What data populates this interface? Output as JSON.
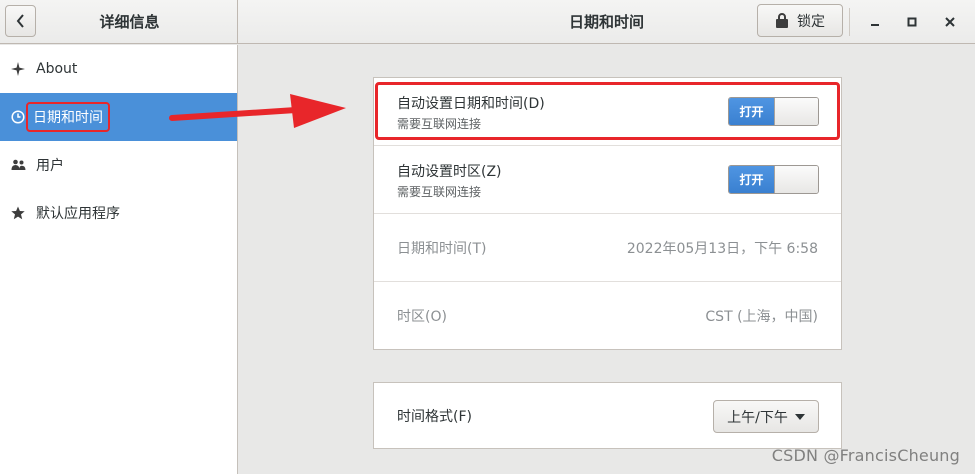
{
  "header": {
    "back_icon": "chevron-left-icon",
    "panel_title": "详细信息",
    "title": "日期和时间",
    "lock_label": "锁定",
    "lock_icon": "lock-icon"
  },
  "window_controls": {
    "minimize_icon": "minimize-icon",
    "maximize_icon": "maximize-icon",
    "close_icon": "close-icon"
  },
  "sidebar": {
    "items": [
      {
        "label": "About",
        "icon": "star-sparkle-icon"
      },
      {
        "label": "日期和时间",
        "icon": "clock-icon",
        "selected": true
      },
      {
        "label": "用户",
        "icon": "users-icon"
      },
      {
        "label": "默认应用程序",
        "icon": "star-icon"
      }
    ]
  },
  "settings": {
    "auto_datetime": {
      "title": "自动设置日期和时间(D)",
      "subtitle": "需要互联网连接",
      "switch_label": "打开"
    },
    "auto_timezone": {
      "title": "自动设置时区(Z)",
      "subtitle": "需要互联网连接",
      "switch_label": "打开"
    },
    "datetime": {
      "title": "日期和时间(T)",
      "value": "2022年05月13日，下午  6:58"
    },
    "timezone": {
      "title": "时区(O)",
      "value": "CST (上海，中国)"
    },
    "time_format": {
      "title": "时间格式(F)",
      "value": "上午/下午"
    }
  },
  "annotation_colors": {
    "highlight": "#e8262a",
    "selected_bg": "#4a90d9"
  },
  "watermark": "CSDN @FrancisCheung"
}
